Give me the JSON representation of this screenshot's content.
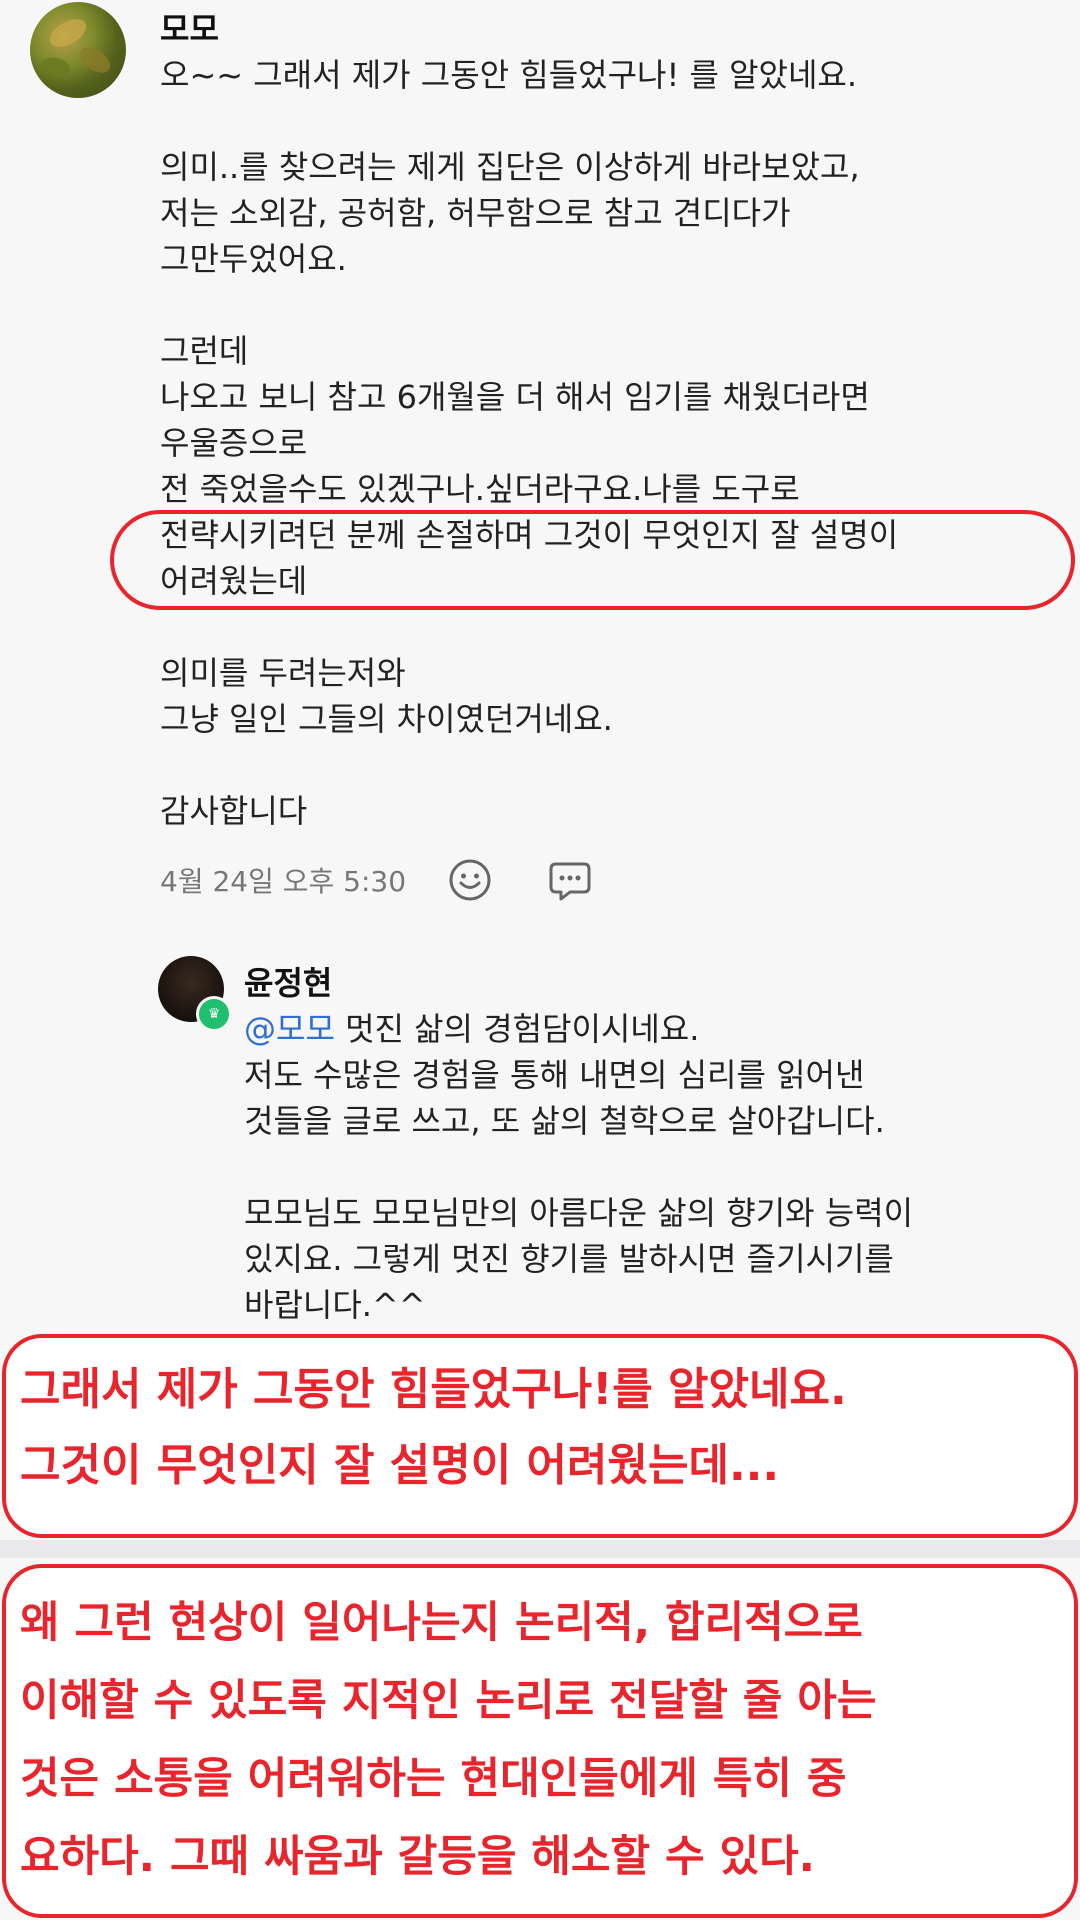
{
  "comment": {
    "author": "모모",
    "text": "오~~ 그래서 제가 그동안 힘들었구나! 를 알았네요.\n\n의미..를 찾으려는 제게 집단은 이상하게 바라보았고,\n저는 소외감, 공허함, 허무함으로 참고 견디다가\n그만두었어요.\n\n그런데\n나오고 보니 참고 6개월을 더 해서 임기를 채웠더라면\n우울증으로\n전 죽었을수도 있겠구나.싶더라구요.나를 도구로\n전략시키려던 분께 손절하며 그것이 무엇인지 잘 설명이\n어려웠는데\n\n의미를 두려는저와\n그냥 일인 그들의 차이였던거네요.\n\n감사합니다",
    "timestamp": "4월 24일 오후 5:30",
    "emoji_icon": "smiley-face-icon",
    "reply_icon": "speech-bubble-icon"
  },
  "reply": {
    "author": "윤정현",
    "badge_icon": "crown-icon",
    "mention": "@모모",
    "text_first_line": " 멋진 삶의 경험담이시네요.",
    "text": "저도 수많은 경험을 통해 내면의 심리를 읽어낸\n것들을 글로 쓰고, 또 삶의 철학으로 살아갑니다.\n\n모모님도 모모님만의 아름다운 삶의 향기와 능력이\n있지요. 그렇게 멋진 향기를 발하시면 즐기시기를\n바랍니다.^^"
  },
  "annotations": {
    "box1": "그래서 제가 그동안 힘들었구나!를 알았네요.\n그것이 무엇인지 잘 설명이 어려웠는데...",
    "box2": "왜 그런 현상이 일어나는지 논리적, 합리적으로\n이해할 수 있도록 지적인 논리로 전달할 줄 아는\n것은 소통을 어려워하는 현대인들에게 특히 중\n요하다. 그때 싸움과 갈등을 해소할 수 있다."
  },
  "colors": {
    "annotation_red": "#e8242c",
    "mention_blue": "#2f6fd1",
    "badge_green": "#1fbf6f"
  }
}
